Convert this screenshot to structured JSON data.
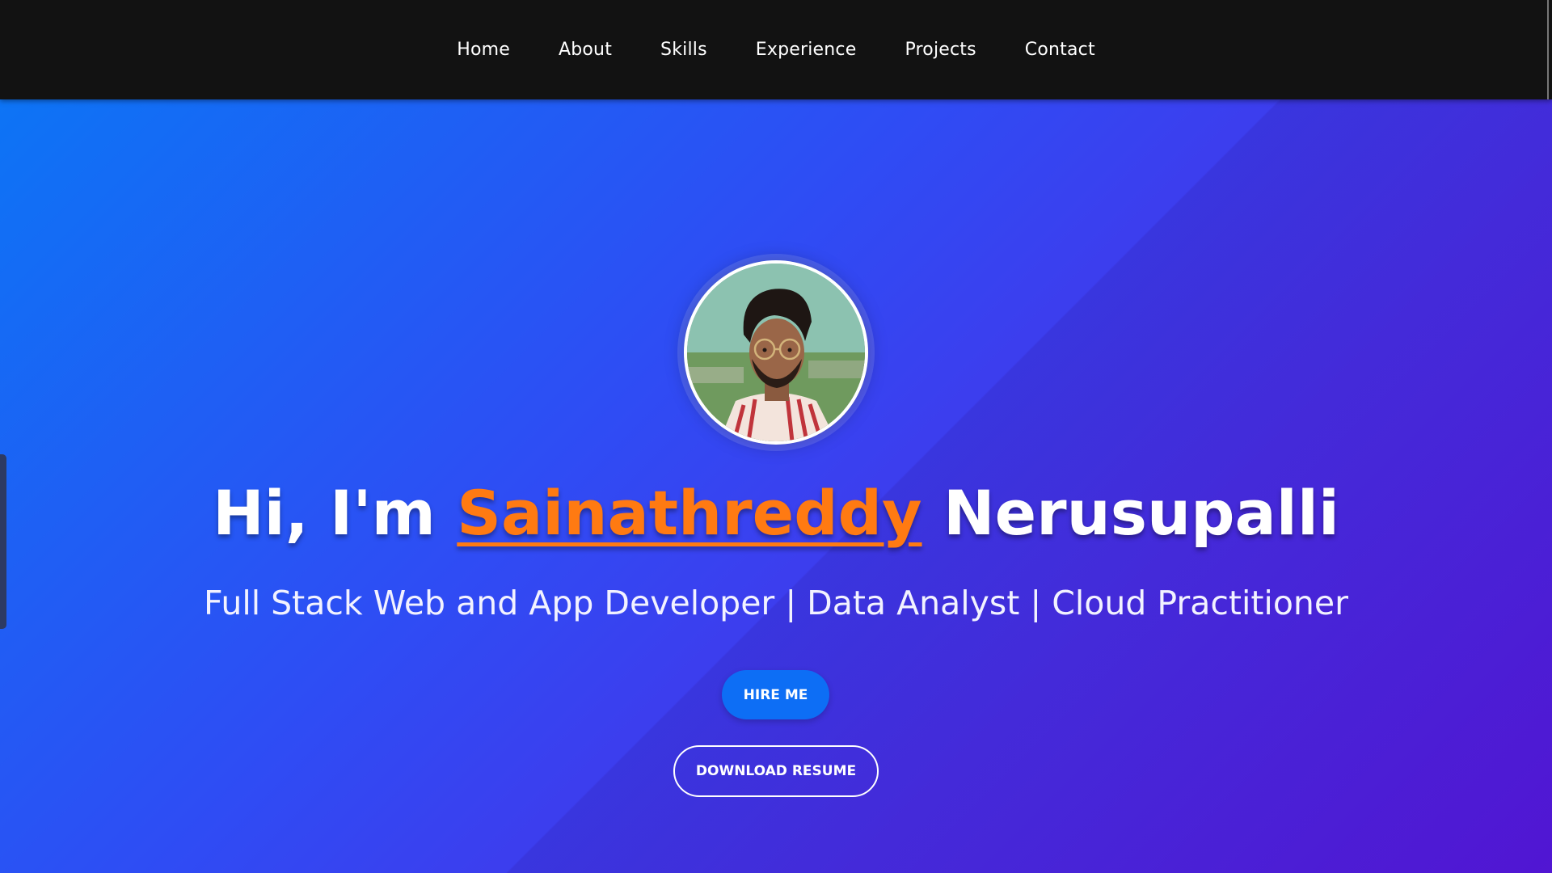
{
  "nav": {
    "items": [
      {
        "label": "Home"
      },
      {
        "label": "About"
      },
      {
        "label": "Skills"
      },
      {
        "label": "Experience"
      },
      {
        "label": "Projects"
      },
      {
        "label": "Contact"
      }
    ]
  },
  "hero": {
    "greeting": "Hi, I'm",
    "first_name": "Sainathreddy",
    "last_name": "Nerusupalli",
    "subtitle": "Full Stack Web and App Developer | Data Analyst | Cloud Practitioner",
    "hire_label": "HIRE ME",
    "resume_label": "DOWNLOAD RESUME"
  },
  "colors": {
    "navbar_bg": "#121212",
    "accent_name": "#ff7a12",
    "hire_button": "#0d6ef5",
    "gradient_start": "#0d74f5",
    "gradient_end": "#5a16e0"
  },
  "icons": {
    "profile": "profile-photo"
  }
}
